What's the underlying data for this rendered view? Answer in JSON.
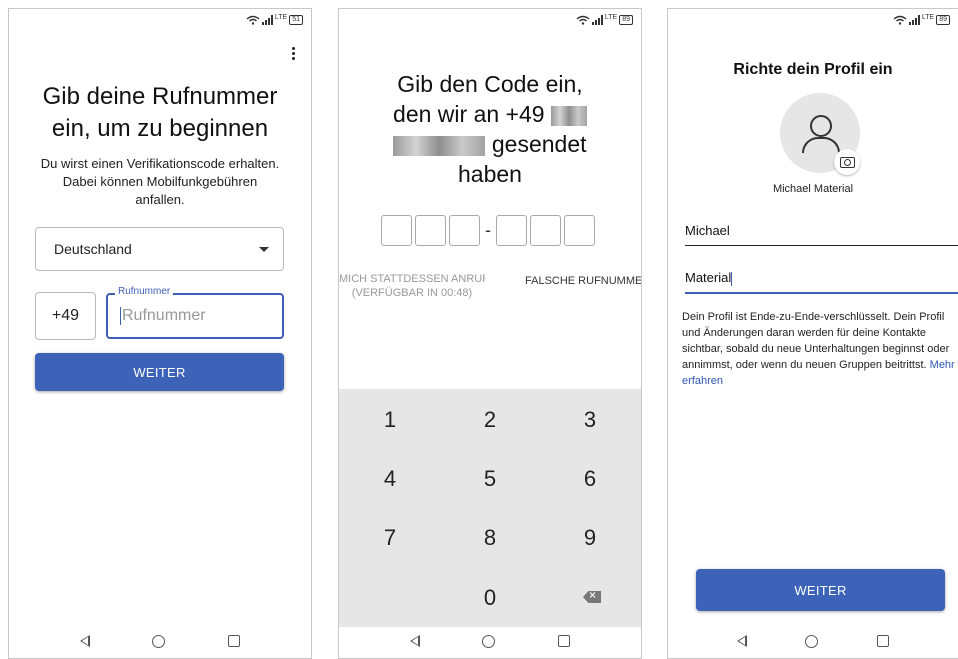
{
  "status": {
    "lte": "LTE",
    "battery_1": "51",
    "battery_2": "89",
    "battery_3": "89"
  },
  "screen1": {
    "title_line1": "Gib deine Rufnummer",
    "title_line2": "ein, um zu beginnen",
    "subtitle_line1": "Du wirst einen Verifikationscode erhalten.",
    "subtitle_line2": "Dabei können Mobilfunkgebühren",
    "subtitle_line3": "anfallen.",
    "country": "Deutschland",
    "country_code": "+49",
    "phone_label": "Rufnummer",
    "phone_placeholder": "Rufnummer",
    "button": "WEITER"
  },
  "screen2": {
    "title_line1": "Gib den Code ein,",
    "title_line2": "den wir an +49",
    "title_line3": "gesendet",
    "title_line4": "haben",
    "code_separator": "-",
    "call_instead_line1": "MICH STATTDESSEN ANRUFEN",
    "call_instead_line2": "(VERFÜGBAR IN 00:48)",
    "wrong_number": "FALSCHE RUFNUMMER",
    "keys": [
      "1",
      "2",
      "3",
      "4",
      "5",
      "6",
      "7",
      "8",
      "9",
      "0"
    ]
  },
  "screen3": {
    "title": "Richte dein Profil ein",
    "display_name": "Michael Material",
    "first_name": "Michael",
    "last_name": "Material",
    "privacy_text": "Dein Profil ist Ende-zu-Ende-verschlüsselt. Dein Profil und Änderungen daran werden für deine Kontakte sichtbar, sobald du neue Unterhaltungen beginnst oder annimmst, oder wenn du neuen Gruppen beitrittst.",
    "privacy_link": "Mehr erfahren",
    "button": "WEITER"
  },
  "colors": {
    "accent": "#3d63b8",
    "keypad": "#e6e6e6",
    "link": "#2f57b5"
  }
}
